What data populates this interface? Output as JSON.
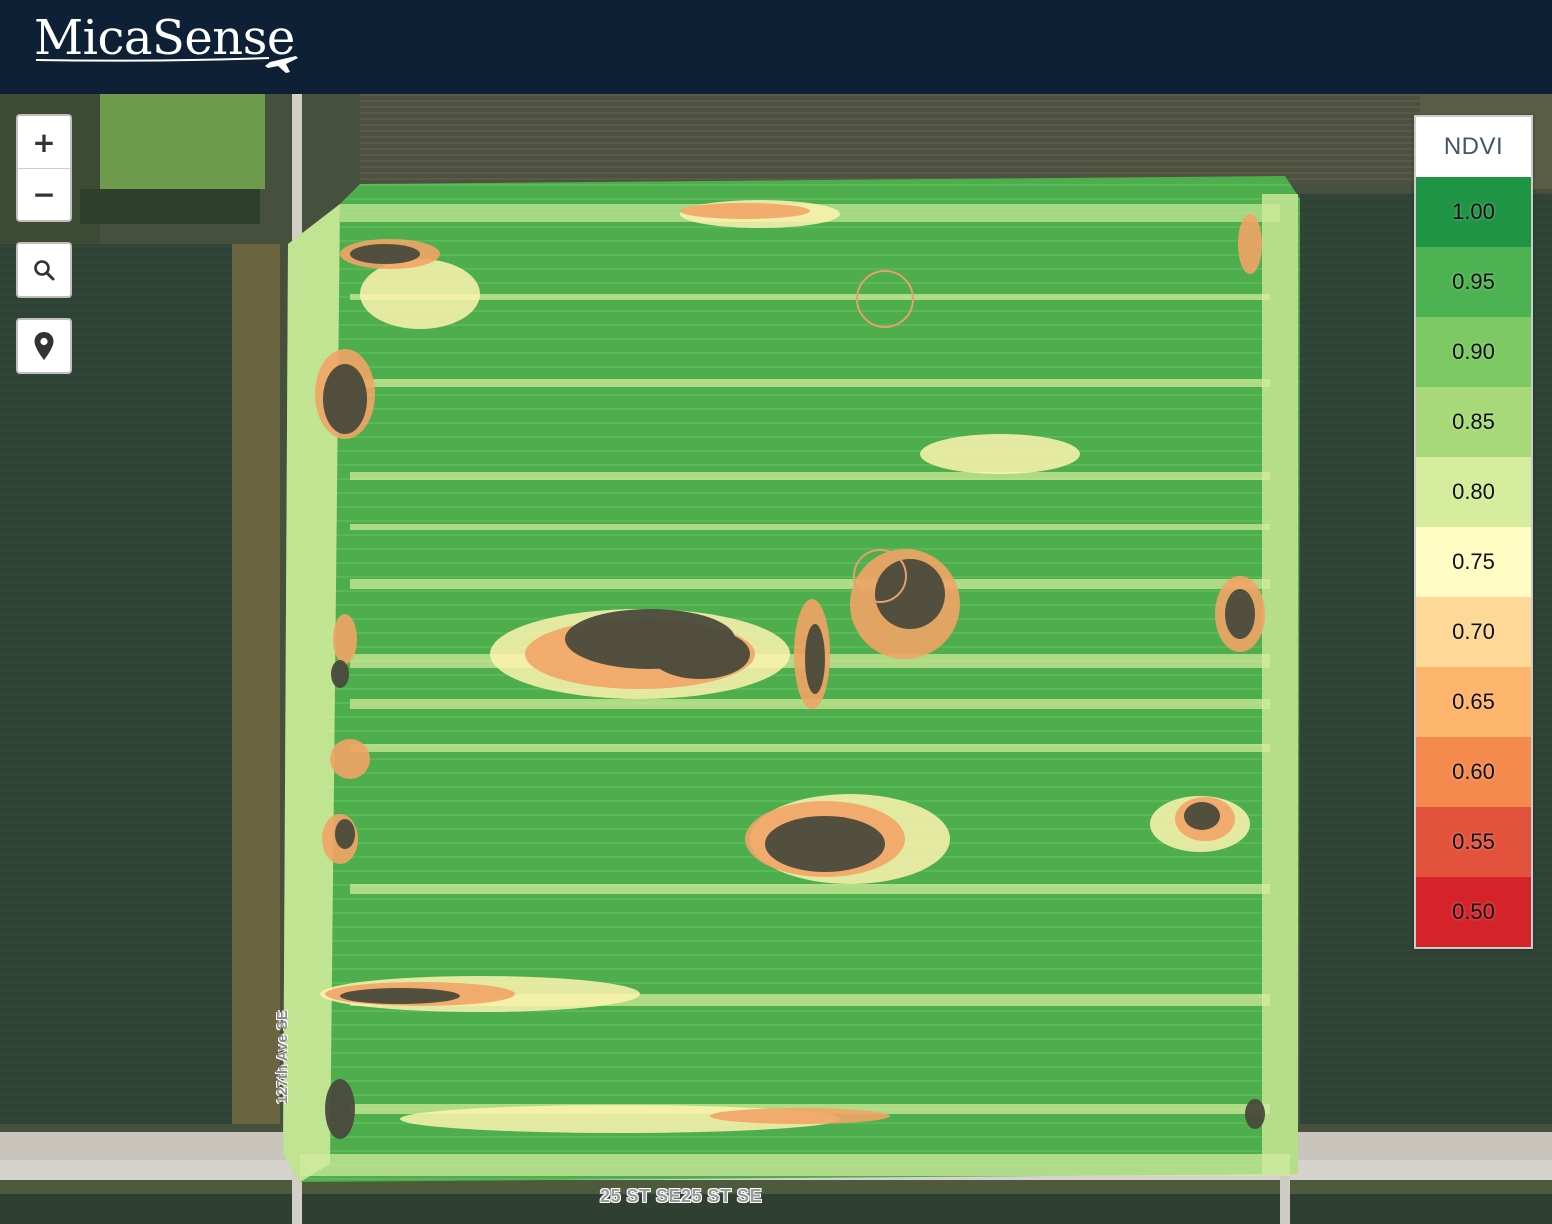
{
  "app": {
    "brand": "MicaSense",
    "logo_icon": "airplane-icon"
  },
  "map_controls": {
    "zoom_in_label": "+",
    "zoom_out_label": "−",
    "search_icon": "search-icon",
    "location_icon": "map-pin-icon"
  },
  "legend": {
    "title": "NDVI",
    "items": [
      {
        "value": "1.00",
        "color": "#1f9445"
      },
      {
        "value": "0.95",
        "color": "#4db352"
      },
      {
        "value": "0.90",
        "color": "#7cc862"
      },
      {
        "value": "0.85",
        "color": "#a8d978"
      },
      {
        "value": "0.80",
        "color": "#d4ec9c"
      },
      {
        "value": "0.75",
        "color": "#fffcc4"
      },
      {
        "value": "0.70",
        "color": "#fed897"
      },
      {
        "value": "0.65",
        "color": "#fdb56d"
      },
      {
        "value": "0.60",
        "color": "#f58a4f"
      },
      {
        "value": "0.55",
        "color": "#e2523c"
      },
      {
        "value": "0.50",
        "color": "#d5232a"
      }
    ]
  },
  "map": {
    "road_label_horizontal": "25 ST SE25 ST SE",
    "road_label_vertical": "127th Ave SE"
  }
}
